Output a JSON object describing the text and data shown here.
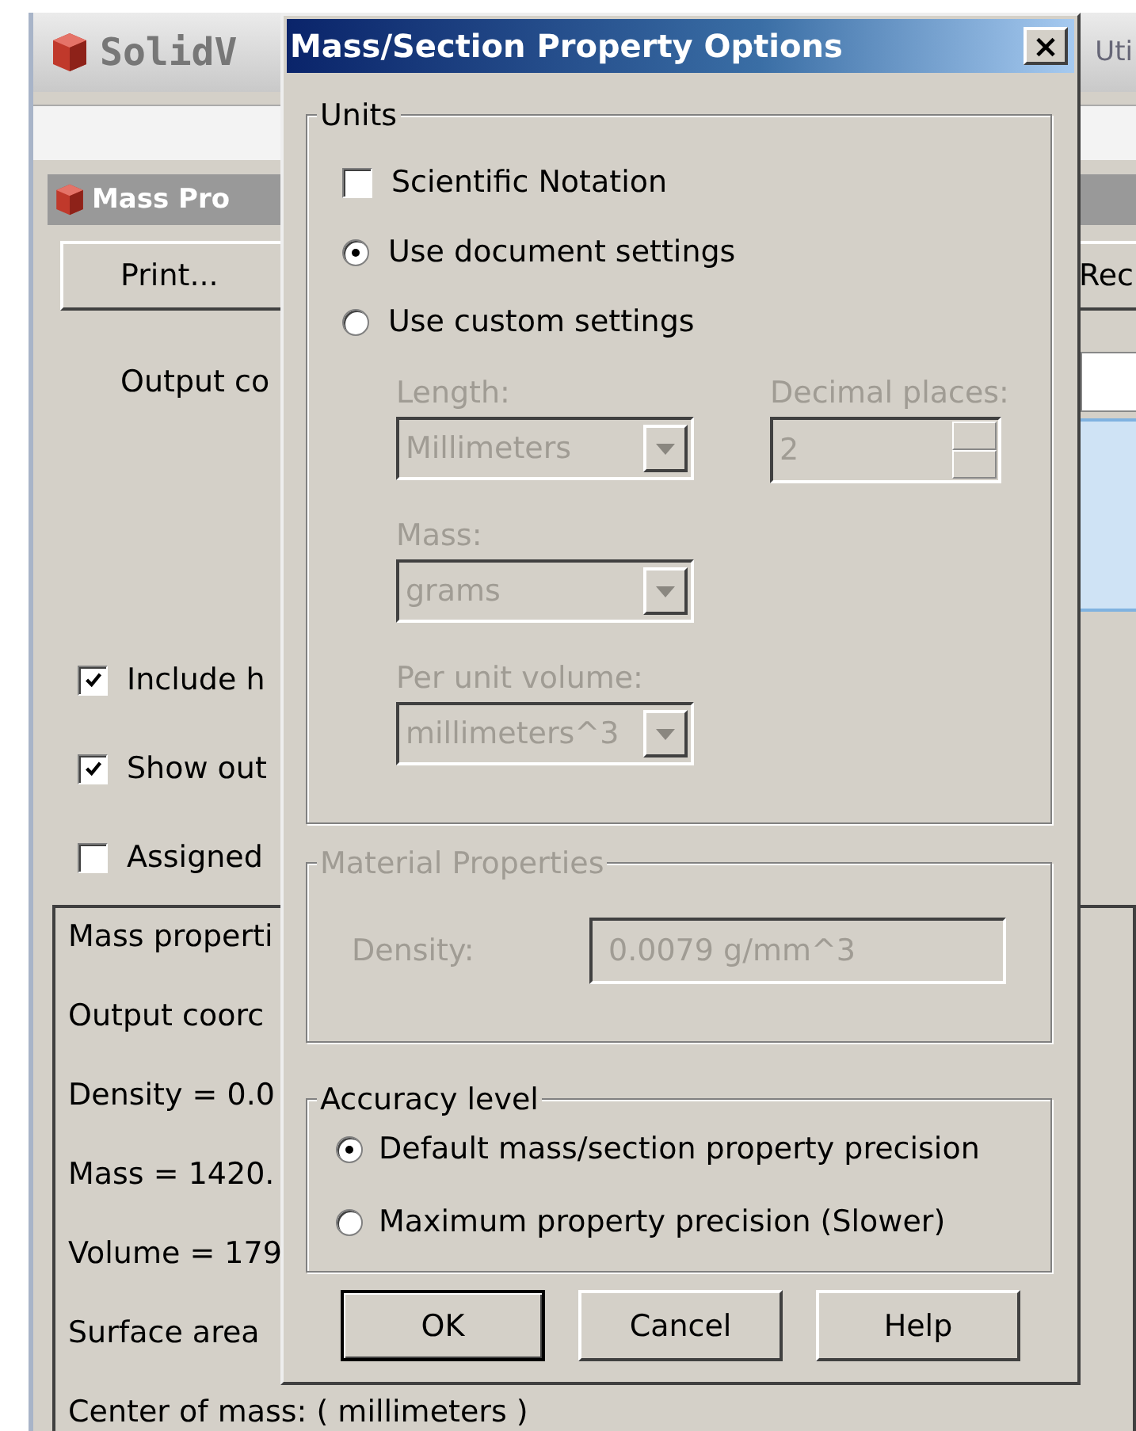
{
  "app_window": {
    "title": "SolidV",
    "title_right": "Uti"
  },
  "mass_properties_window": {
    "title": "Mass Pro",
    "print_button": "Print...",
    "right_button": "Rec",
    "output_label": "Output co",
    "checkboxes": [
      {
        "label": "Include h",
        "checked": true
      },
      {
        "label": "Show out",
        "checked": true
      },
      {
        "label": "Assigned",
        "checked": false
      }
    ],
    "output_lines": [
      "Mass properti",
      "Output  coorc",
      "Density = 0.0",
      "Mass = 1420.",
      "Volume = 179",
      "Surface area",
      "Center of mass: ( millimeters )"
    ]
  },
  "dialog": {
    "title": "Mass/Section Property Options",
    "close": "×",
    "units": {
      "title": "Units",
      "scientific_notation": {
        "label": "Scientific Notation",
        "checked": false
      },
      "options": [
        {
          "label": "Use document settings",
          "selected": true
        },
        {
          "label": "Use custom settings",
          "selected": false
        }
      ],
      "length": {
        "label": "Length:",
        "value": "Millimeters",
        "disabled": true
      },
      "decimal_places": {
        "label": "Decimal places:",
        "value": "2",
        "disabled": true
      },
      "mass": {
        "label": "Mass:",
        "value": "grams",
        "disabled": true
      },
      "per_unit_volume": {
        "label": "Per unit volume:",
        "value": "millimeters^3",
        "disabled": true
      }
    },
    "material_properties": {
      "title": "Material Properties",
      "disabled": true,
      "density_label": "Density:",
      "density_value": "0.0079 g/mm^3"
    },
    "accuracy": {
      "title": "Accuracy level",
      "options": [
        {
          "label": "Default mass/section property precision",
          "selected": true
        },
        {
          "label": "Maximum property precision (Slower)",
          "selected": false
        }
      ]
    },
    "buttons": [
      {
        "label": "OK",
        "default": true
      },
      {
        "label": "Cancel",
        "default": false
      },
      {
        "label": "Help",
        "default": false
      }
    ]
  }
}
